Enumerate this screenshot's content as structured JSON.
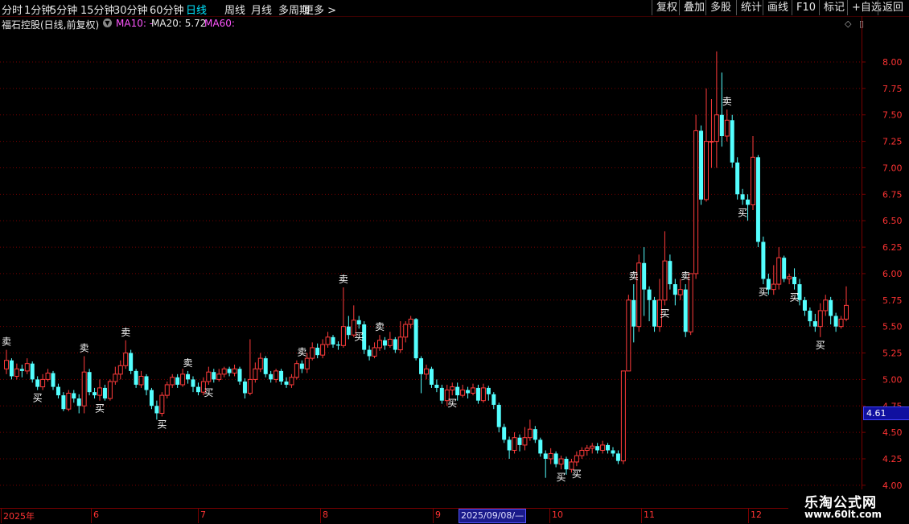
{
  "toolbar": {
    "periods": [
      "分时",
      "1分钟",
      "5分钟",
      "15分钟",
      "30分钟",
      "60分钟",
      "日线",
      "周线",
      "月线",
      "多周期",
      "更多 >"
    ],
    "active_period": "日线",
    "right_buttons": [
      "复权",
      "叠加",
      "多股",
      "统计",
      "画线",
      "F10",
      "标记",
      "+自选",
      "返回"
    ]
  },
  "info": {
    "stock_name": "福石控股(日线,前复权)",
    "ma10": "MA10: -",
    "ma20": "MA20: 5.72",
    "ma60": "MA60:",
    "dropdown_icon": "chevron-down-icon"
  },
  "corner_icons": [
    "diamond-icon",
    "panel-toggle-icon"
  ],
  "last_price": "4.61",
  "watermark": {
    "line1": "乐淘公式网",
    "line2": "www.60lt.com"
  },
  "date_axis": {
    "labels": [
      "2025年",
      "6",
      "7",
      "8",
      "9",
      "10",
      "11",
      "12"
    ],
    "selected": "2025/09/08/—"
  },
  "colors": {
    "up": "#ff3b3b",
    "down": "#54ffff",
    "grid": "#7a0000",
    "axis_text": "#ff3333",
    "background": "#000000"
  },
  "chart_data": {
    "type": "candlestick",
    "price_axis_ticks": [
      "8.00",
      "7.75",
      "7.50",
      "7.25",
      "7.00",
      "6.75",
      "6.50",
      "6.25",
      "6.00",
      "5.75",
      "5.50",
      "5.25",
      "5.00",
      "4.75",
      "4.50",
      "4.25",
      "4.00"
    ],
    "ylim": [
      4.0,
      8.2
    ],
    "signal_labels": {
      "buy": "买",
      "sell": "卖"
    },
    "candles": [
      [
        5.1,
        5.18,
        5.28,
        5.05
      ],
      [
        5.18,
        5.03,
        5.2,
        5.0
      ],
      [
        5.03,
        5.1,
        5.15,
        5.0
      ],
      [
        5.1,
        5.08,
        5.14,
        5.02
      ],
      [
        5.08,
        5.15,
        5.2,
        5.05
      ],
      [
        5.15,
        5.0,
        5.17,
        4.97
      ],
      [
        5.0,
        4.93,
        5.03,
        4.9
      ],
      [
        4.93,
        5.0,
        5.05,
        4.9
      ],
      [
        5.0,
        5.06,
        5.1,
        4.98
      ],
      [
        5.06,
        4.93,
        5.08,
        4.9
      ],
      [
        4.93,
        4.85,
        4.96,
        4.82
      ],
      [
        4.85,
        4.72,
        4.88,
        4.7
      ],
      [
        4.72,
        4.87,
        4.9,
        4.7
      ],
      [
        4.87,
        4.82,
        4.9,
        4.78
      ],
      [
        4.82,
        4.75,
        4.86,
        4.68
      ],
      [
        4.75,
        5.07,
        5.22,
        4.68
      ],
      [
        5.07,
        4.88,
        5.1,
        4.85
      ],
      [
        4.88,
        4.85,
        4.92,
        4.82
      ],
      [
        4.85,
        4.92,
        5.0,
        4.8
      ],
      [
        4.92,
        4.82,
        4.95,
        4.8
      ],
      [
        4.82,
        4.98,
        5.0,
        4.8
      ],
      [
        4.98,
        5.05,
        5.12,
        4.95
      ],
      [
        5.05,
        5.13,
        5.18,
        5.0
      ],
      [
        5.13,
        5.25,
        5.37,
        5.1
      ],
      [
        5.25,
        5.08,
        5.28,
        5.05
      ],
      [
        5.08,
        4.95,
        5.1,
        4.92
      ],
      [
        4.95,
        5.03,
        5.08,
        4.92
      ],
      [
        5.03,
        4.9,
        5.05,
        4.85
      ],
      [
        4.9,
        4.75,
        4.92,
        4.72
      ],
      [
        4.75,
        4.68,
        4.8,
        4.62
      ],
      [
        4.68,
        4.85,
        4.88,
        4.65
      ],
      [
        4.85,
        4.95,
        4.98,
        4.82
      ],
      [
        4.95,
        5.02,
        5.05,
        4.92
      ],
      [
        5.02,
        4.95,
        5.05,
        4.92
      ],
      [
        4.95,
        5.05,
        5.1,
        4.93
      ],
      [
        5.05,
        5.0,
        5.08,
        4.96
      ],
      [
        5.0,
        4.93,
        5.03,
        4.88
      ],
      [
        4.93,
        4.88,
        4.97,
        4.85
      ],
      [
        4.88,
        4.98,
        5.02,
        4.85
      ],
      [
        4.98,
        5.07,
        5.12,
        4.95
      ],
      [
        5.07,
        5.0,
        5.1,
        4.97
      ],
      [
        5.0,
        5.05,
        5.1,
        4.98
      ],
      [
        5.05,
        5.1,
        5.12,
        5.02
      ],
      [
        5.1,
        5.06,
        5.12,
        5.03
      ],
      [
        5.06,
        5.1,
        5.14,
        5.03
      ],
      [
        5.1,
        4.98,
        5.12,
        4.95
      ],
      [
        4.98,
        4.87,
        5.01,
        4.82
      ],
      [
        4.87,
        5.0,
        5.38,
        4.85
      ],
      [
        5.0,
        5.1,
        5.16,
        4.97
      ],
      [
        5.1,
        5.2,
        5.25,
        5.07
      ],
      [
        5.2,
        5.05,
        5.22,
        5.02
      ],
      [
        5.05,
        5.0,
        5.08,
        4.97
      ],
      [
        5.0,
        5.08,
        5.1,
        4.97
      ],
      [
        5.08,
        4.98,
        5.1,
        4.95
      ],
      [
        4.98,
        4.95,
        5.02,
        4.92
      ],
      [
        4.95,
        5.02,
        5.05,
        4.92
      ],
      [
        5.02,
        5.15,
        5.18,
        5.0
      ],
      [
        5.15,
        5.1,
        5.18,
        5.06
      ],
      [
        5.1,
        5.2,
        5.25,
        5.06
      ],
      [
        5.2,
        5.3,
        5.35,
        5.18
      ],
      [
        5.3,
        5.23,
        5.34,
        5.2
      ],
      [
        5.23,
        5.33,
        5.38,
        5.2
      ],
      [
        5.33,
        5.4,
        5.45,
        5.3
      ],
      [
        5.4,
        5.33,
        5.42,
        5.3
      ],
      [
        5.33,
        5.32,
        5.36,
        5.28
      ],
      [
        5.32,
        5.5,
        5.87,
        5.3
      ],
      [
        5.5,
        5.42,
        5.6,
        5.38
      ],
      [
        5.42,
        5.56,
        5.7,
        5.4
      ],
      [
        5.56,
        5.52,
        5.6,
        5.48
      ],
      [
        5.52,
        5.28,
        5.55,
        5.24
      ],
      [
        5.28,
        5.22,
        5.32,
        5.18
      ],
      [
        5.22,
        5.3,
        5.35,
        5.2
      ],
      [
        5.3,
        5.37,
        5.42,
        5.27
      ],
      [
        5.37,
        5.32,
        5.4,
        5.28
      ],
      [
        5.32,
        5.38,
        5.45,
        5.3
      ],
      [
        5.38,
        5.28,
        5.4,
        5.25
      ],
      [
        5.28,
        5.4,
        5.55,
        5.25
      ],
      [
        5.4,
        5.52,
        5.55,
        5.35
      ],
      [
        5.52,
        5.57,
        5.6,
        5.48
      ],
      [
        5.57,
        5.2,
        5.58,
        5.18
      ],
      [
        5.2,
        5.05,
        5.22,
        4.87
      ],
      [
        5.05,
        5.1,
        5.14,
        5.0
      ],
      [
        5.1,
        4.95,
        5.12,
        4.92
      ],
      [
        4.95,
        4.92,
        5.0,
        4.88
      ],
      [
        4.92,
        4.8,
        4.95,
        4.77
      ],
      [
        4.8,
        4.9,
        4.95,
        4.75
      ],
      [
        4.9,
        4.93,
        4.97,
        4.85
      ],
      [
        4.93,
        4.85,
        4.97,
        4.8
      ],
      [
        4.85,
        4.9,
        4.95,
        4.83
      ],
      [
        4.9,
        4.87,
        4.93,
        4.82
      ],
      [
        4.87,
        4.92,
        4.96,
        4.85
      ],
      [
        4.92,
        4.8,
        4.95,
        4.77
      ],
      [
        4.8,
        4.92,
        4.96,
        4.78
      ],
      [
        4.92,
        4.86,
        4.94,
        4.8
      ],
      [
        4.86,
        4.76,
        4.88,
        4.72
      ],
      [
        4.76,
        4.55,
        4.78,
        4.5
      ],
      [
        4.55,
        4.43,
        4.58,
        4.4
      ],
      [
        4.43,
        4.33,
        4.46,
        4.25
      ],
      [
        4.33,
        4.45,
        4.5,
        4.3
      ],
      [
        4.45,
        4.38,
        4.48,
        4.32
      ],
      [
        4.38,
        4.45,
        4.55,
        4.33
      ],
      [
        4.45,
        4.53,
        4.62,
        4.42
      ],
      [
        4.53,
        4.43,
        4.56,
        4.4
      ],
      [
        4.43,
        4.3,
        4.45,
        4.27
      ],
      [
        4.3,
        4.25,
        4.33,
        4.07
      ],
      [
        4.25,
        4.3,
        4.35,
        4.2
      ],
      [
        4.3,
        4.2,
        4.32,
        4.17
      ],
      [
        4.2,
        4.25,
        4.28,
        4.15
      ],
      [
        4.25,
        4.15,
        4.27,
        4.1
      ],
      [
        4.15,
        4.22,
        4.25,
        4.12
      ],
      [
        4.22,
        4.28,
        4.32,
        4.18
      ],
      [
        4.28,
        4.33,
        4.36,
        4.25
      ],
      [
        4.33,
        4.35,
        4.38,
        4.28
      ],
      [
        4.35,
        4.37,
        4.4,
        4.3
      ],
      [
        4.37,
        4.33,
        4.4,
        4.3
      ],
      [
        4.33,
        4.38,
        4.42,
        4.3
      ],
      [
        4.38,
        4.33,
        4.4,
        4.3
      ],
      [
        4.33,
        4.3,
        4.36,
        4.27
      ],
      [
        4.3,
        4.23,
        4.33,
        4.2
      ],
      [
        4.23,
        5.08,
        5.08,
        4.2
      ],
      [
        5.08,
        5.75,
        5.8,
        5.25
      ],
      [
        5.75,
        5.5,
        5.9,
        5.35
      ],
      [
        5.5,
        6.1,
        6.18,
        5.45
      ],
      [
        6.1,
        5.85,
        6.25,
        5.6
      ],
      [
        5.85,
        5.75,
        5.88,
        5.55
      ],
      [
        5.75,
        5.5,
        5.78,
        5.45
      ],
      [
        5.5,
        5.75,
        5.95,
        5.45
      ],
      [
        5.75,
        6.12,
        6.4,
        5.7
      ],
      [
        6.12,
        5.9,
        6.18,
        5.85
      ],
      [
        5.9,
        5.8,
        5.95,
        5.7
      ],
      [
        5.8,
        5.85,
        5.95,
        5.75
      ],
      [
        5.85,
        5.45,
        5.9,
        5.4
      ],
      [
        5.45,
        6.0,
        6.0,
        5.42
      ],
      [
        6.0,
        7.35,
        7.5,
        5.95
      ],
      [
        7.35,
        6.7,
        7.4,
        6.65
      ],
      [
        6.7,
        7.25,
        7.75,
        6.68
      ],
      [
        7.25,
        7.25,
        7.65,
        7.0
      ],
      [
        7.25,
        7.5,
        8.1,
        7.0
      ],
      [
        7.5,
        7.3,
        7.9,
        7.2
      ],
      [
        7.3,
        7.45,
        7.55,
        7.25
      ],
      [
        7.45,
        7.05,
        7.5,
        7.0
      ],
      [
        7.05,
        6.75,
        7.1,
        6.7
      ],
      [
        6.75,
        6.7,
        6.8,
        6.65
      ],
      [
        6.7,
        6.65,
        6.75,
        6.5
      ],
      [
        6.65,
        7.1,
        7.3,
        6.6
      ],
      [
        7.1,
        6.3,
        7.12,
        6.25
      ],
      [
        6.3,
        5.95,
        6.35,
        5.9
      ],
      [
        5.95,
        5.85,
        6.0,
        5.8
      ],
      [
        5.85,
        5.9,
        6.08,
        5.8
      ],
      [
        5.9,
        6.15,
        6.25,
        5.85
      ],
      [
        6.15,
        5.95,
        6.17,
        5.92
      ],
      [
        5.95,
        5.97,
        6.0,
        5.9
      ],
      [
        5.97,
        5.9,
        6.05,
        5.85
      ],
      [
        5.9,
        5.75,
        5.95,
        5.7
      ],
      [
        5.75,
        5.65,
        5.78,
        5.6
      ],
      [
        5.65,
        5.55,
        5.68,
        5.5
      ],
      [
        5.55,
        5.5,
        5.62,
        5.45
      ],
      [
        5.5,
        5.65,
        5.72,
        5.4
      ],
      [
        5.65,
        5.75,
        5.8,
        5.6
      ],
      [
        5.75,
        5.6,
        5.78,
        5.52
      ],
      [
        5.6,
        5.5,
        5.63,
        5.45
      ],
      [
        5.5,
        5.57,
        5.6,
        5.48
      ],
      [
        5.57,
        5.7,
        5.88,
        5.55
      ]
    ]
  }
}
